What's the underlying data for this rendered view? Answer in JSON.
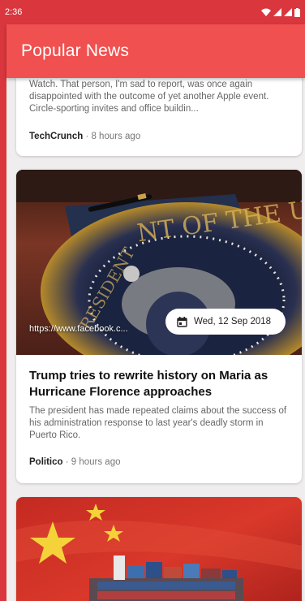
{
  "status_bar": {
    "time": "2:36"
  },
  "app_bar": {
    "title": "Popular News"
  },
  "articles": [
    {
      "description": "Watch. That person, I'm sad to report, was once again disappointed with the outcome of yet another Apple event. Circle-sporting invites and office buildin...",
      "source": "TechCrunch",
      "time_ago": " · 8 hours ago"
    },
    {
      "image_caption_url": "https://www.facebook.c...",
      "date": "Wed, 12 Sep 2018",
      "title": "Trump tries to rewrite history on Maria as Hurricane Florence approaches",
      "description": "The president has made repeated claims about the success of his administration response to last year's deadly storm in Puerto Rico.",
      "source": "Politico",
      "time_ago": " · 9 hours ago"
    },
    {
      "image": "china-flag-cargo-ship"
    }
  ],
  "colors": {
    "accent": "#f0504f",
    "status_bar": "#d9363e"
  }
}
